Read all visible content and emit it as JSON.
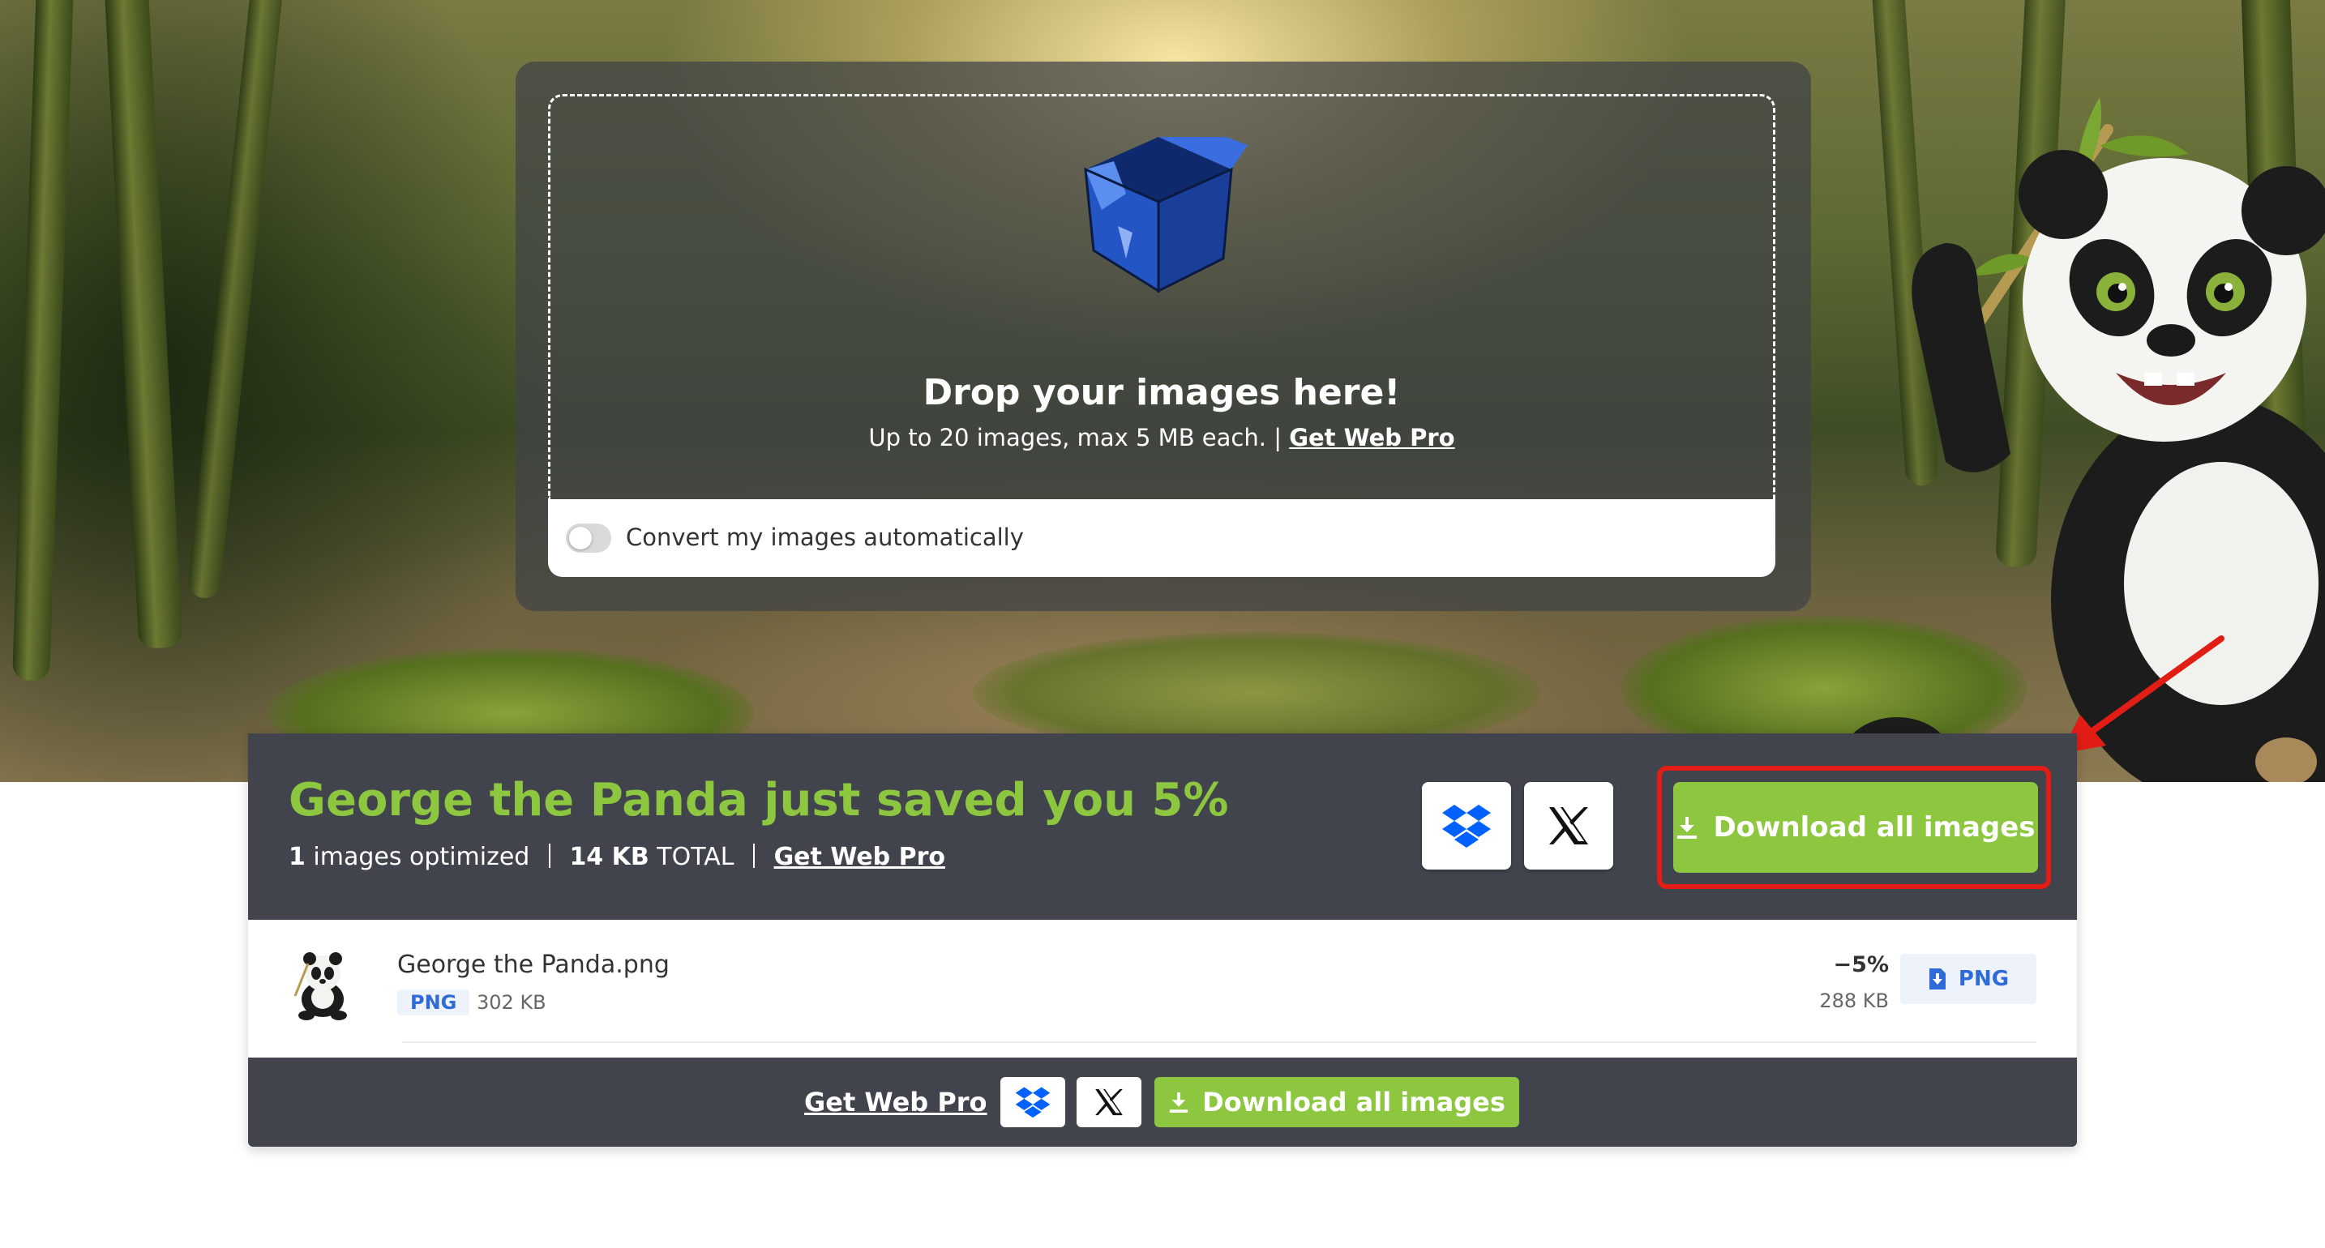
{
  "upload": {
    "title": "Drop your images here!",
    "subtitle": "Up to 20 images, max 5 MB each.",
    "pro_link": "Get Web Pro",
    "auto_convert_label": "Convert my images automatically",
    "auto_convert_enabled": false
  },
  "results": {
    "saved_title": "George the Panda just saved you 5%",
    "count": "1",
    "count_label": "images optimized",
    "total_size": "14 KB",
    "total_label": "TOTAL",
    "pro_link": "Get Web Pro",
    "download_all_label": "Download all images",
    "files": [
      {
        "name": "George the Panda.png",
        "format": "PNG",
        "original_size": "302 KB",
        "savings": "−5%",
        "new_size": "288 KB",
        "download_format": "PNG"
      }
    ],
    "footer": {
      "pro_link": "Get Web Pro",
      "download_all_label": "Download all images"
    }
  },
  "icons": [
    "box-icon",
    "toggle",
    "dropbox-icon",
    "x-icon",
    "download-icon",
    "file-download-icon",
    "arrow-annotation"
  ],
  "colors": {
    "accent_green": "#8dc63f",
    "panel_dark": "#41444c",
    "link_blue": "#2f6bd8",
    "dropbox_blue": "#0061fe",
    "highlight_red": "#e11d16"
  }
}
